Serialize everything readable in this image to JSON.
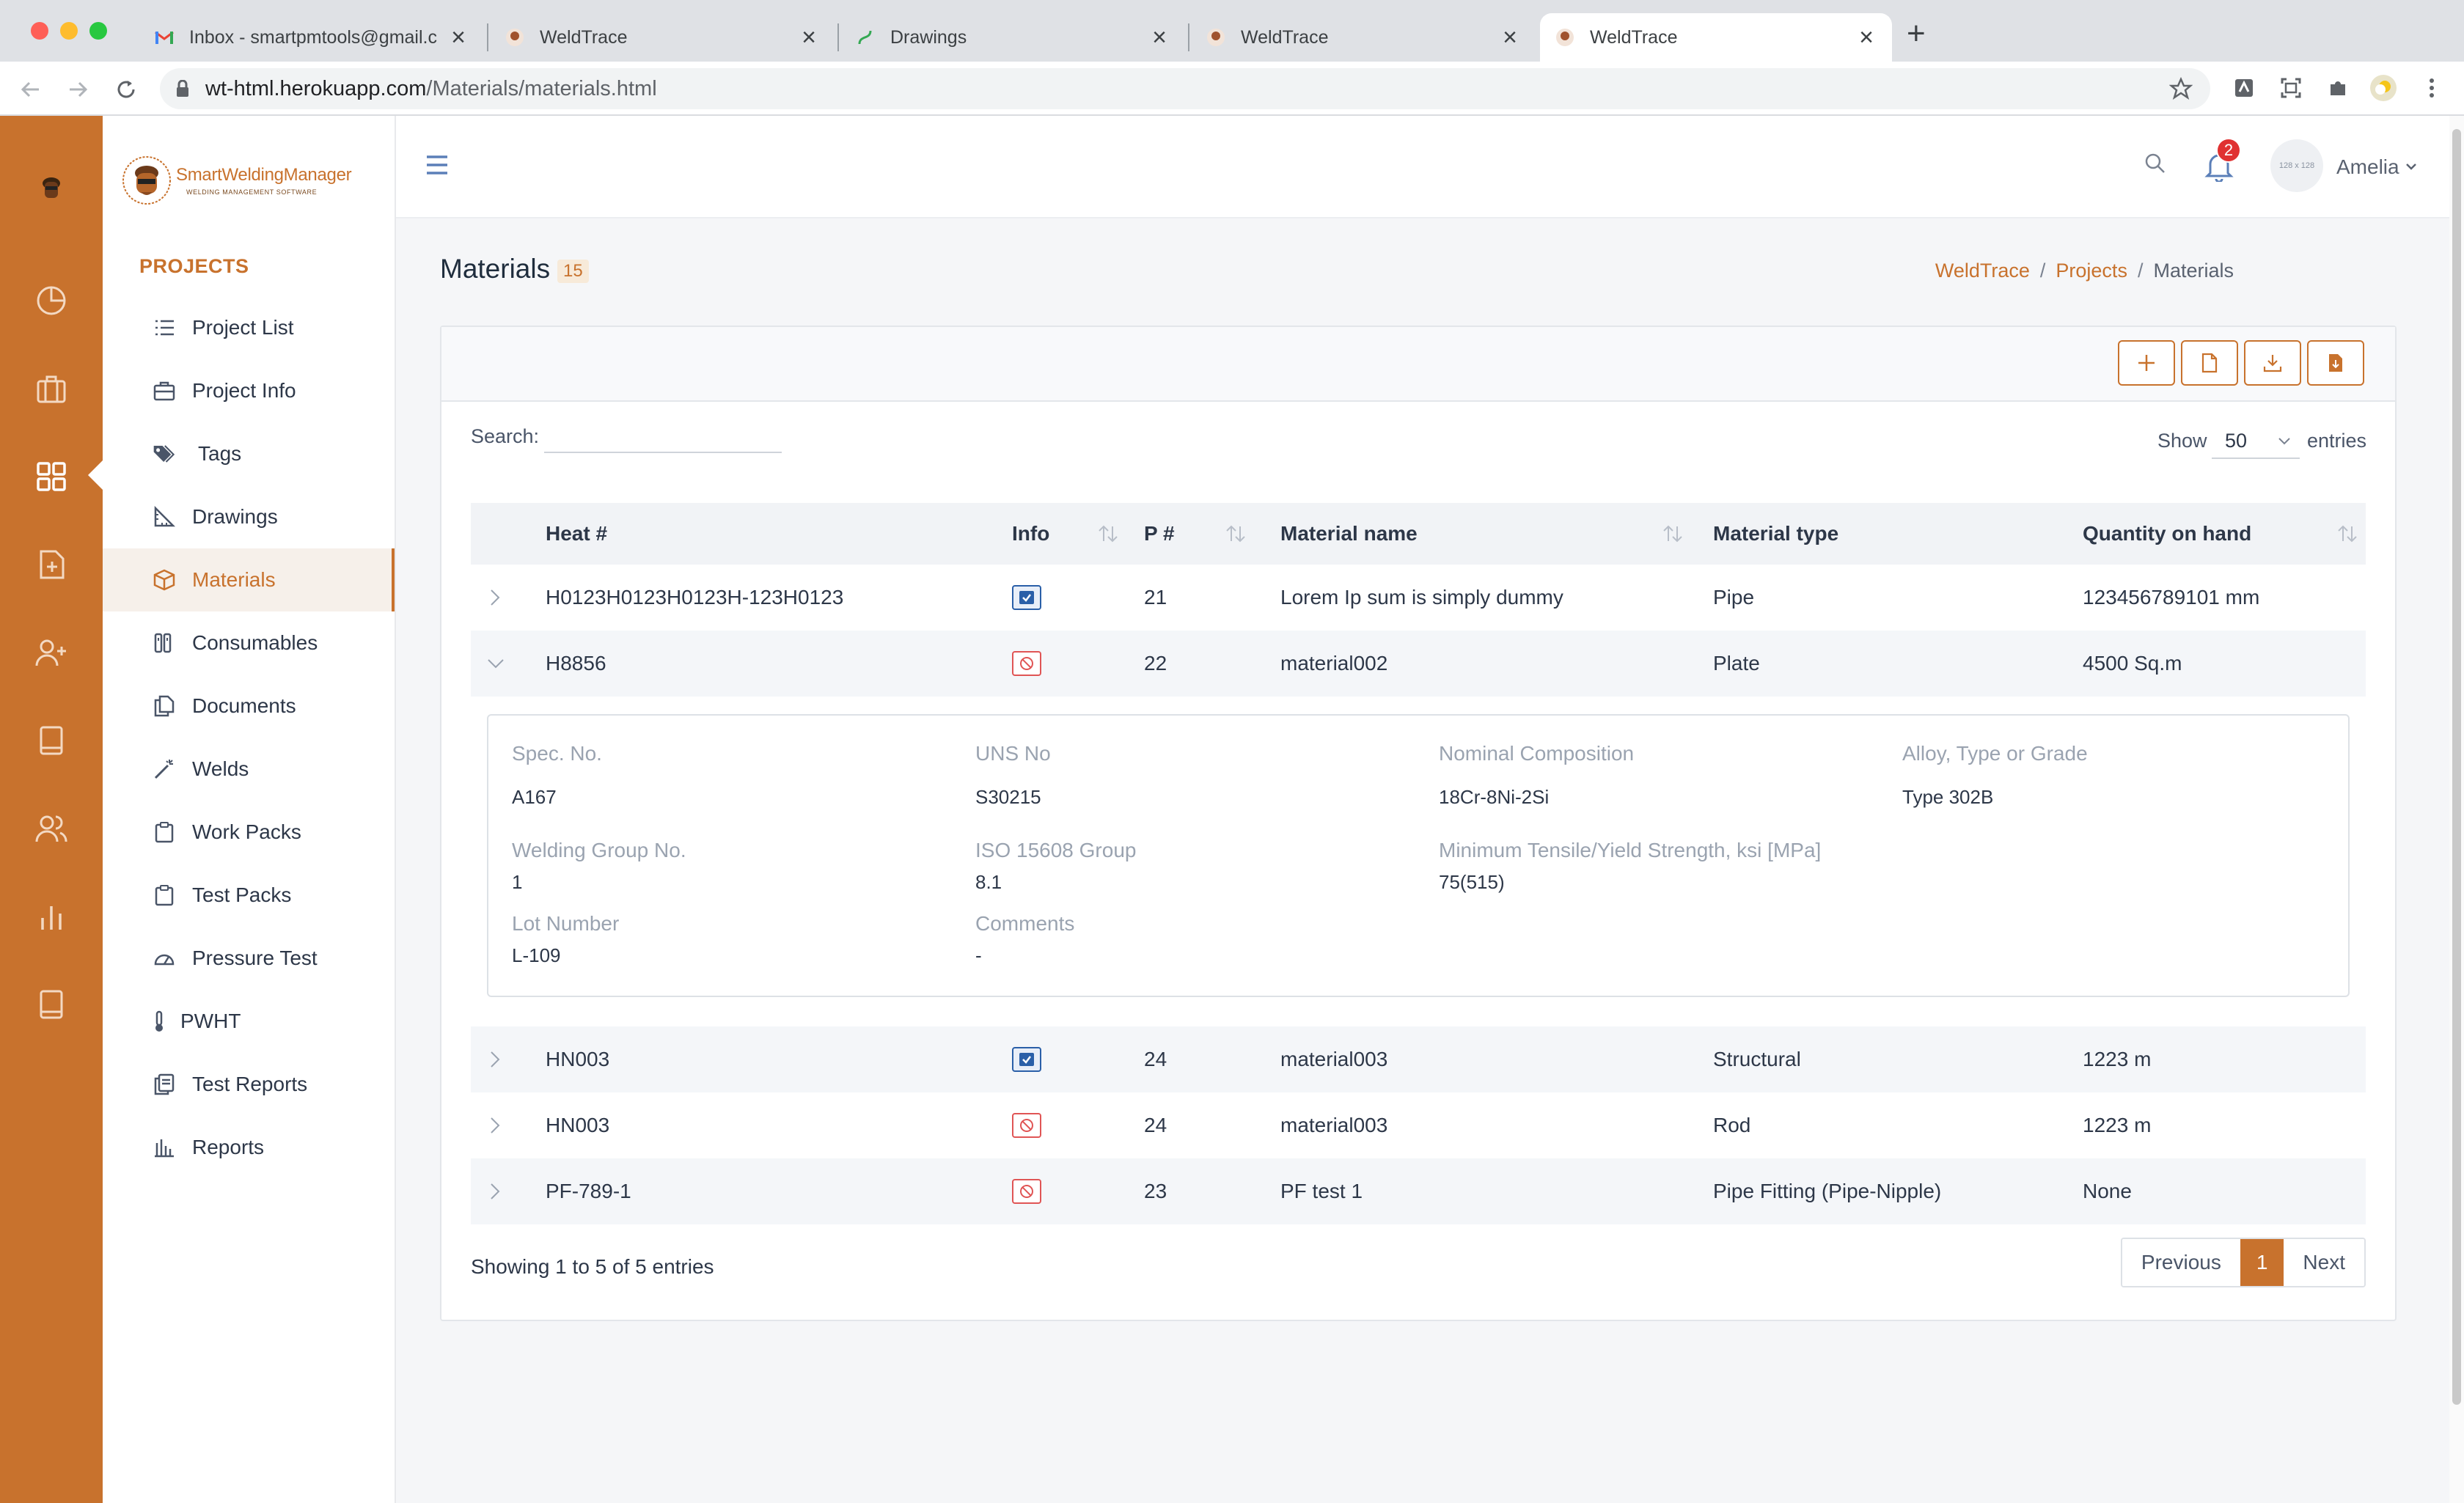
{
  "browser": {
    "tabs": [
      {
        "title": "Inbox - smartpmtools@gmail.c",
        "icon": "gmail-icon"
      },
      {
        "title": "WeldTrace",
        "icon": "weldtrace-favicon"
      },
      {
        "title": "Drawings",
        "icon": "drawings-favicon"
      },
      {
        "title": "WeldTrace",
        "icon": "weldtrace-favicon"
      },
      {
        "title": "WeldTrace",
        "icon": "weldtrace-favicon",
        "active": true
      }
    ],
    "url_host": "wt-html.herokuapp.com",
    "url_path": "/Materials/materials.html"
  },
  "logo": {
    "name": "SmartWeldingManager",
    "subtitle": "WELDING MANAGEMENT SOFTWARE"
  },
  "sidebar": {
    "section": "PROJECTS",
    "items": [
      {
        "label": "Project List",
        "icon": "list-icon"
      },
      {
        "label": "Project Info",
        "icon": "briefcase-icon"
      },
      {
        "label": "Tags",
        "icon": "tags-icon"
      },
      {
        "label": "Drawings",
        "icon": "ruler-icon"
      },
      {
        "label": "Materials",
        "icon": "box-icon",
        "active": true
      },
      {
        "label": "Consumables",
        "icon": "consumables-icon"
      },
      {
        "label": "Documents",
        "icon": "documents-icon"
      },
      {
        "label": "Welds",
        "icon": "wand-icon"
      },
      {
        "label": "Work Packs",
        "icon": "clipboard-icon"
      },
      {
        "label": "Test Packs",
        "icon": "clipboard-icon"
      },
      {
        "label": "Pressure Test",
        "icon": "gauge-icon"
      },
      {
        "label": "PWHT",
        "icon": "thermometer-icon"
      },
      {
        "label": "Test Reports",
        "icon": "reports-icon"
      },
      {
        "label": "Reports",
        "icon": "bar-chart-icon"
      }
    ]
  },
  "topbar": {
    "notifications": "2",
    "avatar_text": "128 x 128",
    "user": "Amelia"
  },
  "page": {
    "title": "Materials",
    "count": "15",
    "breadcrumb": [
      "WeldTrace",
      "Projects",
      "Materials"
    ]
  },
  "table": {
    "search_label": "Search:",
    "search_value": "",
    "show_label": "Show",
    "page_size": "50",
    "entries_label": "entries",
    "columns": [
      "Heat #",
      "Info",
      "P #",
      "Material name",
      "Material type",
      "Quantity on hand"
    ],
    "rows": [
      {
        "heat": "H0123H0123H0123H-123H0123",
        "info": "checked",
        "p": "21",
        "name": "Lorem Ip sum is simply dummy",
        "type": "Pipe",
        "qty": "123456789101 mm"
      },
      {
        "heat": "H8856",
        "info": "blocked",
        "p": "22",
        "name": "material002",
        "type": "Plate",
        "qty": "4500 Sq.m",
        "expanded": true
      },
      {
        "heat": "HN003",
        "info": "checked",
        "p": "24",
        "name": "material003",
        "type": "Structural",
        "qty": "1223 m"
      },
      {
        "heat": "HN003",
        "info": "blocked",
        "p": "24",
        "name": "material003",
        "type": "Rod",
        "qty": "1223 m"
      },
      {
        "heat": "PF-789-1",
        "info": "blocked",
        "p": "23",
        "name": "PF test 1",
        "type": "Pipe Fitting (Pipe-Nipple)",
        "qty": "None"
      }
    ],
    "detail": {
      "spec_label": "Spec. No.",
      "spec": "A167",
      "uns_label": "UNS No",
      "uns": "S30215",
      "nominal_label": "Nominal Composition",
      "nominal": "18Cr-8Ni-2Si",
      "alloy_label": "Alloy, Type or Grade",
      "alloy": "Type 302B",
      "wgroup_label": "Welding Group No.",
      "wgroup": "1",
      "iso_label": "ISO 15608 Group",
      "iso": "8.1",
      "tensile_label": "Minimum Tensile/Yield Strength, ksi [MPa]",
      "tensile": "75(515)",
      "lot_label": "Lot Number",
      "lot": "L-109",
      "comments_label": "Comments",
      "comments": "-"
    },
    "showing": "Showing 1 to 5 of 5 entries",
    "pager": {
      "prev": "Previous",
      "current": "1",
      "next": "Next"
    }
  },
  "colors": {
    "accent": "#c8722d",
    "link": "#2a5fa8",
    "danger": "#e05555"
  }
}
